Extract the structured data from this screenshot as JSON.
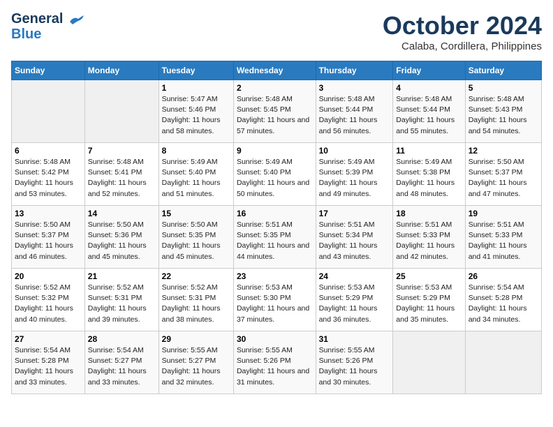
{
  "header": {
    "logo_line1": "General",
    "logo_line2": "Blue",
    "month_title": "October 2024",
    "location": "Calaba, Cordillera, Philippines"
  },
  "weekdays": [
    "Sunday",
    "Monday",
    "Tuesday",
    "Wednesday",
    "Thursday",
    "Friday",
    "Saturday"
  ],
  "weeks": [
    [
      {
        "day": null
      },
      {
        "day": null
      },
      {
        "day": "1",
        "sunrise": "Sunrise: 5:47 AM",
        "sunset": "Sunset: 5:46 PM",
        "daylight": "Daylight: 11 hours and 58 minutes."
      },
      {
        "day": "2",
        "sunrise": "Sunrise: 5:48 AM",
        "sunset": "Sunset: 5:45 PM",
        "daylight": "Daylight: 11 hours and 57 minutes."
      },
      {
        "day": "3",
        "sunrise": "Sunrise: 5:48 AM",
        "sunset": "Sunset: 5:44 PM",
        "daylight": "Daylight: 11 hours and 56 minutes."
      },
      {
        "day": "4",
        "sunrise": "Sunrise: 5:48 AM",
        "sunset": "Sunset: 5:44 PM",
        "daylight": "Daylight: 11 hours and 55 minutes."
      },
      {
        "day": "5",
        "sunrise": "Sunrise: 5:48 AM",
        "sunset": "Sunset: 5:43 PM",
        "daylight": "Daylight: 11 hours and 54 minutes."
      }
    ],
    [
      {
        "day": "6",
        "sunrise": "Sunrise: 5:48 AM",
        "sunset": "Sunset: 5:42 PM",
        "daylight": "Daylight: 11 hours and 53 minutes."
      },
      {
        "day": "7",
        "sunrise": "Sunrise: 5:48 AM",
        "sunset": "Sunset: 5:41 PM",
        "daylight": "Daylight: 11 hours and 52 minutes."
      },
      {
        "day": "8",
        "sunrise": "Sunrise: 5:49 AM",
        "sunset": "Sunset: 5:40 PM",
        "daylight": "Daylight: 11 hours and 51 minutes."
      },
      {
        "day": "9",
        "sunrise": "Sunrise: 5:49 AM",
        "sunset": "Sunset: 5:40 PM",
        "daylight": "Daylight: 11 hours and 50 minutes."
      },
      {
        "day": "10",
        "sunrise": "Sunrise: 5:49 AM",
        "sunset": "Sunset: 5:39 PM",
        "daylight": "Daylight: 11 hours and 49 minutes."
      },
      {
        "day": "11",
        "sunrise": "Sunrise: 5:49 AM",
        "sunset": "Sunset: 5:38 PM",
        "daylight": "Daylight: 11 hours and 48 minutes."
      },
      {
        "day": "12",
        "sunrise": "Sunrise: 5:50 AM",
        "sunset": "Sunset: 5:37 PM",
        "daylight": "Daylight: 11 hours and 47 minutes."
      }
    ],
    [
      {
        "day": "13",
        "sunrise": "Sunrise: 5:50 AM",
        "sunset": "Sunset: 5:37 PM",
        "daylight": "Daylight: 11 hours and 46 minutes."
      },
      {
        "day": "14",
        "sunrise": "Sunrise: 5:50 AM",
        "sunset": "Sunset: 5:36 PM",
        "daylight": "Daylight: 11 hours and 45 minutes."
      },
      {
        "day": "15",
        "sunrise": "Sunrise: 5:50 AM",
        "sunset": "Sunset: 5:35 PM",
        "daylight": "Daylight: 11 hours and 45 minutes."
      },
      {
        "day": "16",
        "sunrise": "Sunrise: 5:51 AM",
        "sunset": "Sunset: 5:35 PM",
        "daylight": "Daylight: 11 hours and 44 minutes."
      },
      {
        "day": "17",
        "sunrise": "Sunrise: 5:51 AM",
        "sunset": "Sunset: 5:34 PM",
        "daylight": "Daylight: 11 hours and 43 minutes."
      },
      {
        "day": "18",
        "sunrise": "Sunrise: 5:51 AM",
        "sunset": "Sunset: 5:33 PM",
        "daylight": "Daylight: 11 hours and 42 minutes."
      },
      {
        "day": "19",
        "sunrise": "Sunrise: 5:51 AM",
        "sunset": "Sunset: 5:33 PM",
        "daylight": "Daylight: 11 hours and 41 minutes."
      }
    ],
    [
      {
        "day": "20",
        "sunrise": "Sunrise: 5:52 AM",
        "sunset": "Sunset: 5:32 PM",
        "daylight": "Daylight: 11 hours and 40 minutes."
      },
      {
        "day": "21",
        "sunrise": "Sunrise: 5:52 AM",
        "sunset": "Sunset: 5:31 PM",
        "daylight": "Daylight: 11 hours and 39 minutes."
      },
      {
        "day": "22",
        "sunrise": "Sunrise: 5:52 AM",
        "sunset": "Sunset: 5:31 PM",
        "daylight": "Daylight: 11 hours and 38 minutes."
      },
      {
        "day": "23",
        "sunrise": "Sunrise: 5:53 AM",
        "sunset": "Sunset: 5:30 PM",
        "daylight": "Daylight: 11 hours and 37 minutes."
      },
      {
        "day": "24",
        "sunrise": "Sunrise: 5:53 AM",
        "sunset": "Sunset: 5:29 PM",
        "daylight": "Daylight: 11 hours and 36 minutes."
      },
      {
        "day": "25",
        "sunrise": "Sunrise: 5:53 AM",
        "sunset": "Sunset: 5:29 PM",
        "daylight": "Daylight: 11 hours and 35 minutes."
      },
      {
        "day": "26",
        "sunrise": "Sunrise: 5:54 AM",
        "sunset": "Sunset: 5:28 PM",
        "daylight": "Daylight: 11 hours and 34 minutes."
      }
    ],
    [
      {
        "day": "27",
        "sunrise": "Sunrise: 5:54 AM",
        "sunset": "Sunset: 5:28 PM",
        "daylight": "Daylight: 11 hours and 33 minutes."
      },
      {
        "day": "28",
        "sunrise": "Sunrise: 5:54 AM",
        "sunset": "Sunset: 5:27 PM",
        "daylight": "Daylight: 11 hours and 33 minutes."
      },
      {
        "day": "29",
        "sunrise": "Sunrise: 5:55 AM",
        "sunset": "Sunset: 5:27 PM",
        "daylight": "Daylight: 11 hours and 32 minutes."
      },
      {
        "day": "30",
        "sunrise": "Sunrise: 5:55 AM",
        "sunset": "Sunset: 5:26 PM",
        "daylight": "Daylight: 11 hours and 31 minutes."
      },
      {
        "day": "31",
        "sunrise": "Sunrise: 5:55 AM",
        "sunset": "Sunset: 5:26 PM",
        "daylight": "Daylight: 11 hours and 30 minutes."
      },
      {
        "day": null
      },
      {
        "day": null
      }
    ]
  ]
}
